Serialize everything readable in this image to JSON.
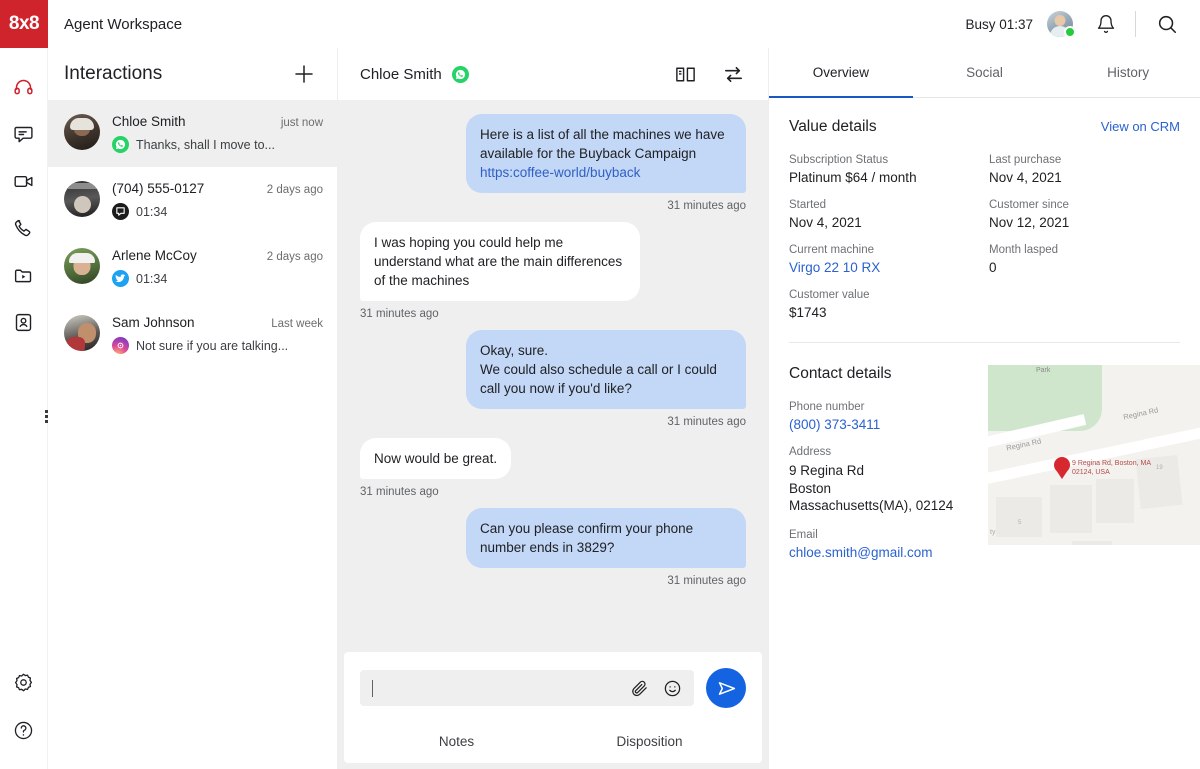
{
  "topbar": {
    "logo_text": "8x8",
    "app_title": "Agent Workspace",
    "status_text": "Busy 01:37",
    "bell_icon": "bell-icon",
    "search_icon": "search-icon"
  },
  "rail": {
    "items": [
      {
        "icon": "headset-icon",
        "active": true
      },
      {
        "icon": "chat-bubble-icon",
        "active": false
      },
      {
        "icon": "video-camera-icon",
        "active": false
      },
      {
        "icon": "phone-icon",
        "active": false
      },
      {
        "icon": "folder-play-icon",
        "active": false
      },
      {
        "icon": "contact-card-icon",
        "active": false
      }
    ],
    "bottom_items": [
      {
        "icon": "gear-icon"
      },
      {
        "icon": "help-circle-icon"
      }
    ]
  },
  "interactions": {
    "title": "Interactions",
    "add_icon": "plus-icon",
    "conversations": [
      {
        "name": "Chloe Smith",
        "time": "just now",
        "snippet": "Thanks, shall I move to...",
        "channel": "whatsapp",
        "active": true
      },
      {
        "name": "(704) 555-0127",
        "time": "2 days ago",
        "snippet": "01:34",
        "channel": "sms",
        "active": false
      },
      {
        "name": "Arlene McCoy",
        "time": "2 days ago",
        "snippet": "01:34",
        "channel": "twitter",
        "active": false
      },
      {
        "name": "Sam Johnson",
        "time": "Last week",
        "snippet": "Not sure if you are talking...",
        "channel": "instagram",
        "active": false
      }
    ]
  },
  "chat": {
    "contact_name": "Chloe Smith",
    "channel": "whatsapp",
    "knowledge_icon": "book-icon",
    "transfer_icon": "transfer-arrows-icon",
    "messages": [
      {
        "direction": "out",
        "text": "Here is a list of all the machines we have available for the Buyback Campaign ",
        "link": "https:coffee-world/buyback",
        "time": "31 minutes ago"
      },
      {
        "direction": "in",
        "text": "I was hoping you could help me understand what are the main differences of the machines",
        "link": "",
        "time": "31 minutes ago"
      },
      {
        "direction": "out",
        "text": "Okay, sure.\nWe could also schedule a call or I could call you now if you'd like?",
        "link": "",
        "time": "31 minutes ago"
      },
      {
        "direction": "in",
        "text": "Now would be great.",
        "link": "",
        "time": "31 minutes ago"
      },
      {
        "direction": "out",
        "text": "Can you please confirm your phone number ends in 3829?",
        "link": "",
        "time": "31 minutes ago"
      }
    ],
    "composer": {
      "value": "",
      "placeholder": "",
      "attach_icon": "paperclip-icon",
      "emoji_icon": "smiley-icon",
      "send_icon": "send-icon",
      "tabs": [
        {
          "label": "Notes"
        },
        {
          "label": "Disposition"
        }
      ]
    }
  },
  "right_panel": {
    "tabs": [
      {
        "label": "Overview",
        "active": true
      },
      {
        "label": "Social",
        "active": false
      },
      {
        "label": "History",
        "active": false
      }
    ],
    "value_details": {
      "title": "Value details",
      "crm_link": "View on CRM",
      "fields": [
        {
          "label": "Subscription Status",
          "value": "Platinum  $64 / month",
          "is_link": false
        },
        {
          "label": "Last purchase",
          "value": "Nov 4, 2021",
          "is_link": false
        },
        {
          "label": "Started",
          "value": "Nov 4, 2021",
          "is_link": false
        },
        {
          "label": "Customer since",
          "value": "Nov 12, 2021",
          "is_link": false
        },
        {
          "label": "Current machine",
          "value": "Virgo 22 10 RX",
          "is_link": true
        },
        {
          "label": "Month lasped",
          "value": "0",
          "is_link": false
        },
        {
          "label": "Customer value",
          "value": "$1743",
          "is_link": false
        }
      ]
    },
    "contact_details": {
      "title": "Contact details",
      "phone_label": "Phone number",
      "phone_value": "(800) 373-3411",
      "address_label": "Address",
      "address_line1": "9 Regina Rd",
      "address_line2": "Boston",
      "address_line3": "Massachusetts(MA), 02124",
      "email_label": "Email",
      "email_value": "chloe.smith@gmail.com",
      "map": {
        "park_label": "Park",
        "road_label_1": "Regina Rd",
        "road_label_2": "Regina Rd",
        "pin_label": "9 Regina Rd, Boston, MA 02124, USA",
        "block_num_1": "5",
        "block_num_2": "19",
        "edge_label": "ty"
      }
    }
  },
  "colors": {
    "brand_red": "#d0242c",
    "accent_blue": "#1463e0",
    "link_blue": "#2a62d0",
    "bubble_out": "#c3d7f7",
    "chat_bg": "#efefef",
    "presence_green": "#27c93f"
  }
}
